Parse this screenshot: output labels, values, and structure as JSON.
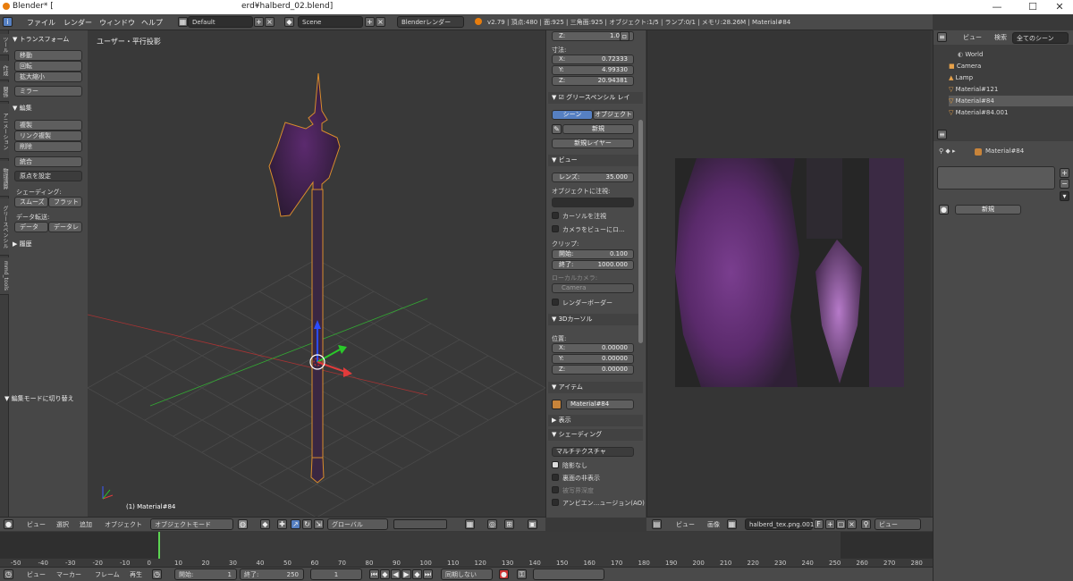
{
  "window": {
    "app_title": "Blender* [",
    "file_path": "erd¥halberd_02.blend]",
    "min": "—",
    "max": "☐",
    "close": "✕"
  },
  "info_header": {
    "menus": [
      "ファイル",
      "レンダー",
      "ウィンドウ",
      "ヘルプ"
    ],
    "layout": "Default",
    "scene": "Scene",
    "engine": "Blenderレンダー",
    "stats": "v2.79 | 頂点:480 | 面:925 | 三角面:925 | オブジェクト:1/5 | ランプ:0/1 | メモリ:28.26M | Material#84"
  },
  "toolshelf": {
    "tabs": [
      "ツール",
      "作成",
      "関係",
      "アニメーション",
      "物理演算",
      "グリースペンシル",
      "mmd_tools"
    ],
    "transform_header": "▼ トランスフォーム",
    "transform_buttons": [
      "移動",
      "回転",
      "拡大縮小"
    ],
    "mirror": "ミラー",
    "edit_header": "▼ 編集",
    "edit_buttons": [
      "複製",
      "リンク複製",
      "削除"
    ],
    "join": "統合",
    "origin": "原点を設定",
    "shading_label": "シェーディング:",
    "smooth": "スムーズ",
    "flat": "フラット",
    "data_transfer": "データ転送:",
    "data": "データ",
    "data_l": "データレ",
    "history": "▶ 履歴",
    "last_op": "▼ 編集モードに切り替え"
  },
  "viewport": {
    "title": "ユーザー・平行投影",
    "object_label": "(1) Material#84"
  },
  "props_panel": {
    "z_scale": {
      "label": "Z:",
      "value": "1.000"
    },
    "dimensions_label": "寸法:",
    "dims": [
      {
        "label": "X:",
        "value": "0.72333"
      },
      {
        "label": "Y:",
        "value": "4.99330"
      },
      {
        "label": "Z:",
        "value": "20.94381"
      }
    ],
    "grease_header": "▼ ☑ グリースペンシル レイ",
    "scene_tab": "シーン",
    "object_tab": "オブジェクト",
    "new_btn": "新規",
    "new_layer": "新規レイヤー",
    "view_header": "▼ ビュー",
    "lens": {
      "label": "レンズ:",
      "value": "35.000"
    },
    "lock_object": "オブジェクトに注視:",
    "lock_cursor": "カーソルを注視",
    "lock_camera": "カメラをビューにロ...",
    "clip_label": "クリップ:",
    "clip_start": {
      "label": "開始:",
      "value": "0.100"
    },
    "clip_end": {
      "label": "終了:",
      "value": "1000.000"
    },
    "local_camera": "ローカルカメラ:",
    "camera_field": "Camera",
    "render_border": "レンダーボーダー",
    "cursor_header": "▼ 3Dカーソル",
    "location_label": "位置:",
    "cursor": [
      {
        "label": "X:",
        "value": "0.00000"
      },
      {
        "label": "Y:",
        "value": "0.00000"
      },
      {
        "label": "Z:",
        "value": "0.00000"
      }
    ],
    "item_header": "▼ アイテム",
    "item_name": "Material#84",
    "display_header": "▶ 表示",
    "shading_header": "▼ シェーディング",
    "multitexture": "マルチテクスチャ",
    "shadeless": "陰影なし",
    "backface": "裏面の非表示",
    "depth_of_field": "被写界深度",
    "ambient_occlusion": "アンビエン...ュージョン(AO)"
  },
  "outliner": {
    "view": "ビュー",
    "search": "検索",
    "all_scenes": "全てのシーン",
    "items": [
      "World",
      "Camera",
      "Lamp",
      "Material#121",
      "Material#84",
      "Material#84.001"
    ],
    "selected_index": 4
  },
  "right_props": {
    "breadcrumb": "Material#84",
    "new_btn": "新規"
  },
  "view3d_header": {
    "menus": [
      "ビュー",
      "選択",
      "追加",
      "オブジェクト"
    ],
    "mode": "オブジェクトモード",
    "orientation": "グローバル"
  },
  "image_header": {
    "menus": [
      "ビュー",
      "画像"
    ],
    "image_name": "halberd_tex.png.001",
    "f": "F",
    "view": "ビュー"
  },
  "timeline": {
    "ticks": [
      "-50",
      "-40",
      "-30",
      "-20",
      "-10",
      "0",
      "10",
      "20",
      "30",
      "40",
      "50",
      "60",
      "70",
      "80",
      "90",
      "100",
      "110",
      "120",
      "130",
      "140",
      "150",
      "160",
      "170",
      "180",
      "190",
      "200",
      "210",
      "220",
      "230",
      "240",
      "250",
      "260",
      "270",
      "280"
    ],
    "current_frame": "1",
    "start": {
      "label": "開始:",
      "value": "1"
    },
    "end": {
      "label": "終了:",
      "value": "250"
    },
    "sync": "同期しない",
    "menus": [
      "ビュー",
      "マーカー",
      "フレーム",
      "再生"
    ]
  },
  "colors": {
    "accent": "#5680c2",
    "select": "#f1a33c",
    "purple": "#8a3fa0"
  }
}
